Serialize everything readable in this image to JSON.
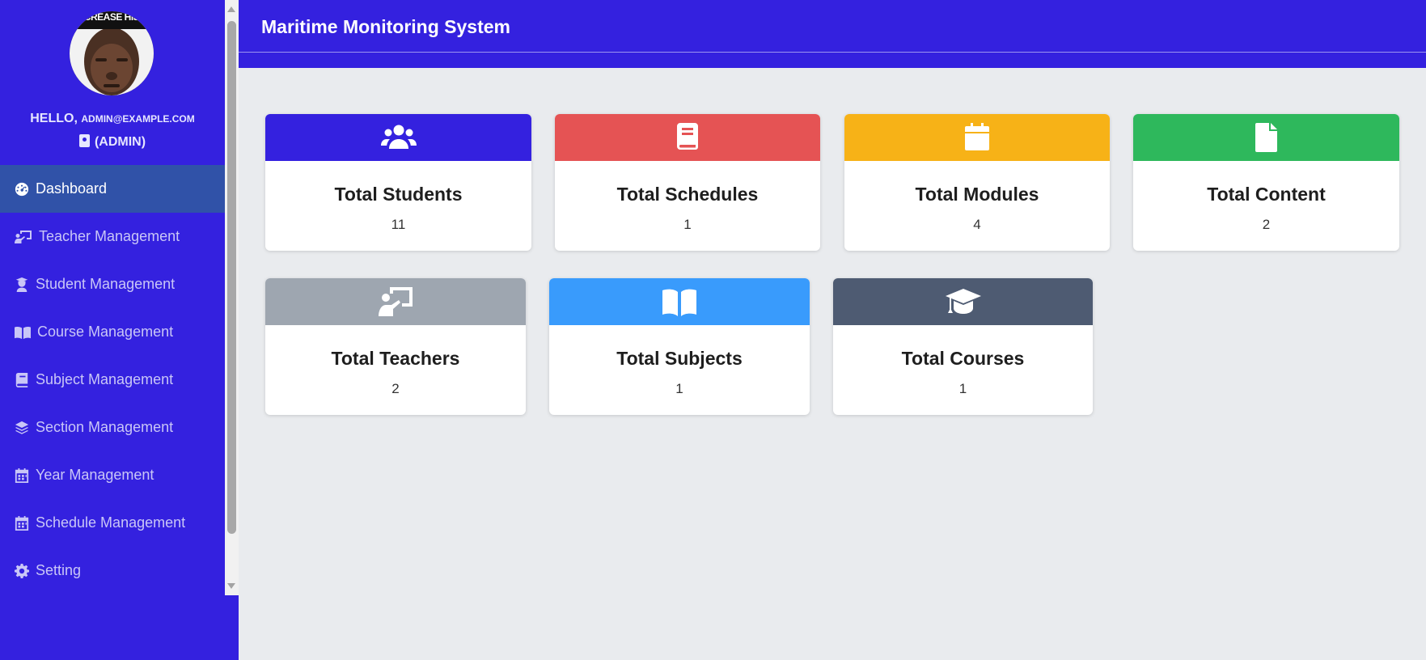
{
  "app": {
    "title": "Maritime Monitoring System"
  },
  "user": {
    "avatar_caption": "CREASE HIS",
    "hello": "HELLO,",
    "email": "admin@example.com",
    "role": "(ADMIN)"
  },
  "sidebar": {
    "items": [
      {
        "label": "Dashboard",
        "icon": "dashboard-icon",
        "active": true
      },
      {
        "label": "Teacher Management",
        "icon": "chalkboard-teacher-icon"
      },
      {
        "label": "Student Management",
        "icon": "user-graduate-icon"
      },
      {
        "label": "Course Management",
        "icon": "book-open-icon"
      },
      {
        "label": "Subject Management",
        "icon": "book-icon"
      },
      {
        "label": "Section Management",
        "icon": "layer-group-icon"
      },
      {
        "label": "Year Management",
        "icon": "calendar-icon"
      },
      {
        "label": "Schedule Management",
        "icon": "calendar-icon"
      },
      {
        "label": "Setting",
        "icon": "gear-icon"
      }
    ]
  },
  "cards": [
    {
      "title": "Total Students",
      "value": "11",
      "color": "#3421df",
      "icon": "users-icon"
    },
    {
      "title": "Total Schedules",
      "value": "1",
      "color": "#e55354",
      "icon": "book-icon"
    },
    {
      "title": "Total Modules",
      "value": "4",
      "color": "#f7b217",
      "icon": "calendar-icon"
    },
    {
      "title": "Total Content",
      "value": "2",
      "color": "#2eb85c",
      "icon": "file-icon"
    },
    {
      "title": "Total Teachers",
      "value": "2",
      "color": "#9ea6b0",
      "icon": "chalkboard-teacher-icon"
    },
    {
      "title": "Total Subjects",
      "value": "1",
      "color": "#399bfc",
      "icon": "book-open-icon"
    },
    {
      "title": "Total Courses",
      "value": "1",
      "color": "#4e5b72",
      "icon": "graduation-cap-icon"
    }
  ]
}
